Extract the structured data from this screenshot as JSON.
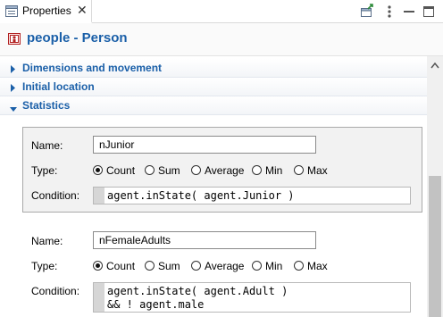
{
  "tab": {
    "title": "Properties",
    "close_glyph": "✕"
  },
  "toolbar": {
    "icons": [
      "pin-view-icon",
      "view-menu-icon",
      "minimize-icon",
      "maximize-icon"
    ]
  },
  "header": {
    "title": "people - Person",
    "icon": "agent-population-icon"
  },
  "sections": [
    {
      "label": "Dimensions and movement",
      "expanded": false
    },
    {
      "label": "Initial location",
      "expanded": false
    },
    {
      "label": "Statistics",
      "expanded": true
    }
  ],
  "statistics": [
    {
      "name_label": "Name:",
      "name_value": "nJunior",
      "type_label": "Type:",
      "type_options": [
        "Count",
        "Sum",
        "Average",
        "Min",
        "Max"
      ],
      "type_selected": "Count",
      "condition_label": "Condition:",
      "condition_lines": [
        "agent.inState( agent.Junior )"
      ]
    },
    {
      "name_label": "Name:",
      "name_value": "nFemaleAdults",
      "type_label": "Type:",
      "type_options": [
        "Count",
        "Sum",
        "Average",
        "Min",
        "Max"
      ],
      "type_selected": "Count",
      "condition_label": "Condition:",
      "condition_lines": [
        "agent.inState( agent.Adult )",
        "&& ! agent.male"
      ]
    }
  ],
  "colors": {
    "accent": "#1a5fa8",
    "scroll_thumb": "#c2c2c2",
    "stat_box_bg": "#f2f2f2"
  }
}
